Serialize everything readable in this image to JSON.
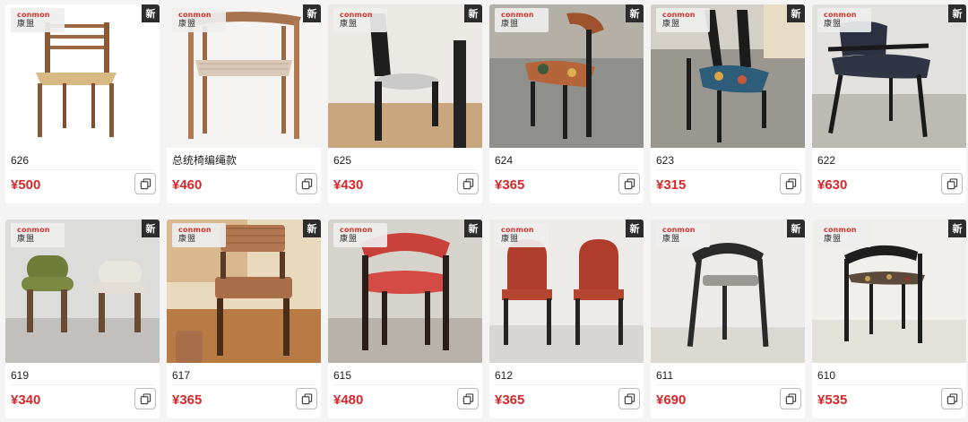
{
  "brand": {
    "logo_text": "conmon",
    "logo_cn": "康盟"
  },
  "new_badge": "新",
  "cart_icon": "copy-to-cart-icon",
  "products": [
    {
      "name": "626",
      "price": "¥500",
      "image": "natural-wood-rope-chair"
    },
    {
      "name": "总统椅编绳款",
      "price": "¥460",
      "image": "presidential-armchair-rope"
    },
    {
      "name": "625",
      "price": "¥430",
      "image": "black-highback-chair"
    },
    {
      "name": "624",
      "price": "¥365",
      "image": "floral-upholstered-chair"
    },
    {
      "name": "623",
      "price": "¥315",
      "image": "black-frame-blue-seat-chair"
    },
    {
      "name": "622",
      "price": "¥630",
      "image": "black-armchair"
    },
    {
      "name": "619",
      "price": "¥340",
      "image": "green-white-round-chairs"
    },
    {
      "name": "617",
      "price": "¥365",
      "image": "houndstooth-walnut-chair"
    },
    {
      "name": "615",
      "price": "¥480",
      "image": "red-curved-armchair"
    },
    {
      "name": "612",
      "price": "¥365",
      "image": "red-arched-back-chairs"
    },
    {
      "name": "611",
      "price": "¥690",
      "image": "black-minimal-armchair"
    },
    {
      "name": "610",
      "price": "¥535",
      "image": "black-patterned-seat-armchair"
    }
  ]
}
